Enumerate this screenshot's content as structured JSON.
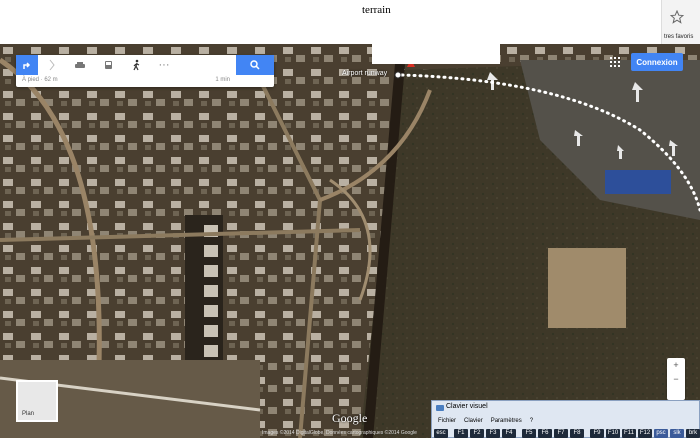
{
  "window_title": "terrain",
  "favorites_label": "tres favoris",
  "search": {
    "walk_info": "À pied · 62 m",
    "walk_time": "1 min",
    "more_label": "···"
  },
  "top_right": {
    "connexion_label": "Connexion"
  },
  "map": {
    "pin_label": "Airport runway",
    "google_logo": "Google",
    "footer": "Images ©2014 DigitalGlobe, Données cartographiques ©2014 Google"
  },
  "plan_tile": {
    "label": "Plan"
  },
  "zoom": {
    "plus": "+",
    "minus": "−"
  },
  "keyboard": {
    "title": "Clavier visuel",
    "menu": [
      "Fichier",
      "Clavier",
      "Paramètres",
      "?"
    ],
    "keys": [
      "esc",
      "F1",
      "F2",
      "F3",
      "F4",
      "F5",
      "F6",
      "F7",
      "F8",
      "F9",
      "F10",
      "F11",
      "F12",
      "psc",
      "slk",
      "brk"
    ]
  },
  "colors": {
    "accent": "#4285f4",
    "route_dots": "#ffffff",
    "terrain_dark": "#3b3226",
    "terrain_sand": "#9a8466"
  }
}
